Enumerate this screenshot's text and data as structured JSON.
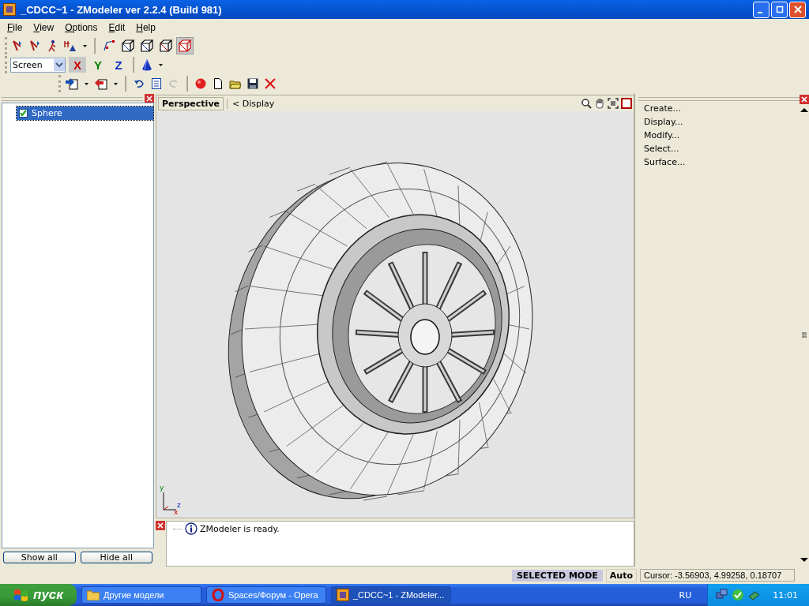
{
  "window": {
    "title": "_CDCC~1 - ZModeler ver 2.2.4 (Build 981)"
  },
  "menu": [
    "File",
    "View",
    "Options",
    "Edit",
    "Help"
  ],
  "mode_buttons": [
    {
      "selected": false
    },
    {
      "selected": false
    },
    {
      "selected": false
    },
    {
      "selected": false
    },
    {
      "selected": true
    }
  ],
  "coordinate_system": {
    "value": "Screen"
  },
  "axes": [
    {
      "label": "X",
      "selected": true,
      "color": "#cc0000"
    },
    {
      "label": "Y",
      "selected": false,
      "color": "#008000"
    },
    {
      "label": "Z",
      "selected": false,
      "color": "#1030c0"
    }
  ],
  "tree": {
    "items": [
      {
        "label": "Sphere",
        "checked": true,
        "selected": true
      }
    ]
  },
  "tree_buttons": [
    "Show all",
    "Hide all"
  ],
  "viewport": {
    "tab": "Perspective",
    "breadcrumb": "< Display",
    "gizmo_labels": [
      "y",
      "z",
      "x"
    ]
  },
  "log": [
    "ZModeler is ready."
  ],
  "commands": [
    "Create...",
    "Display...",
    "Modify...",
    "Select...",
    "Surface..."
  ],
  "status_bar": {
    "mode": "SELECTED MODE",
    "snap": "Auto",
    "cursor": "Cursor: -3.56903, 4.99258, 0.18707"
  },
  "taskbar": {
    "start": "пуск",
    "tasks": [
      {
        "label": "Другие модели",
        "selected": false,
        "kind": "folder"
      },
      {
        "label": "Spaces/Форум - Opera",
        "selected": false,
        "kind": "opera"
      },
      {
        "label": "_CDCC~1 - ZModeler...",
        "selected": true,
        "kind": "app"
      }
    ],
    "language": "RU",
    "clock": "11:01"
  }
}
